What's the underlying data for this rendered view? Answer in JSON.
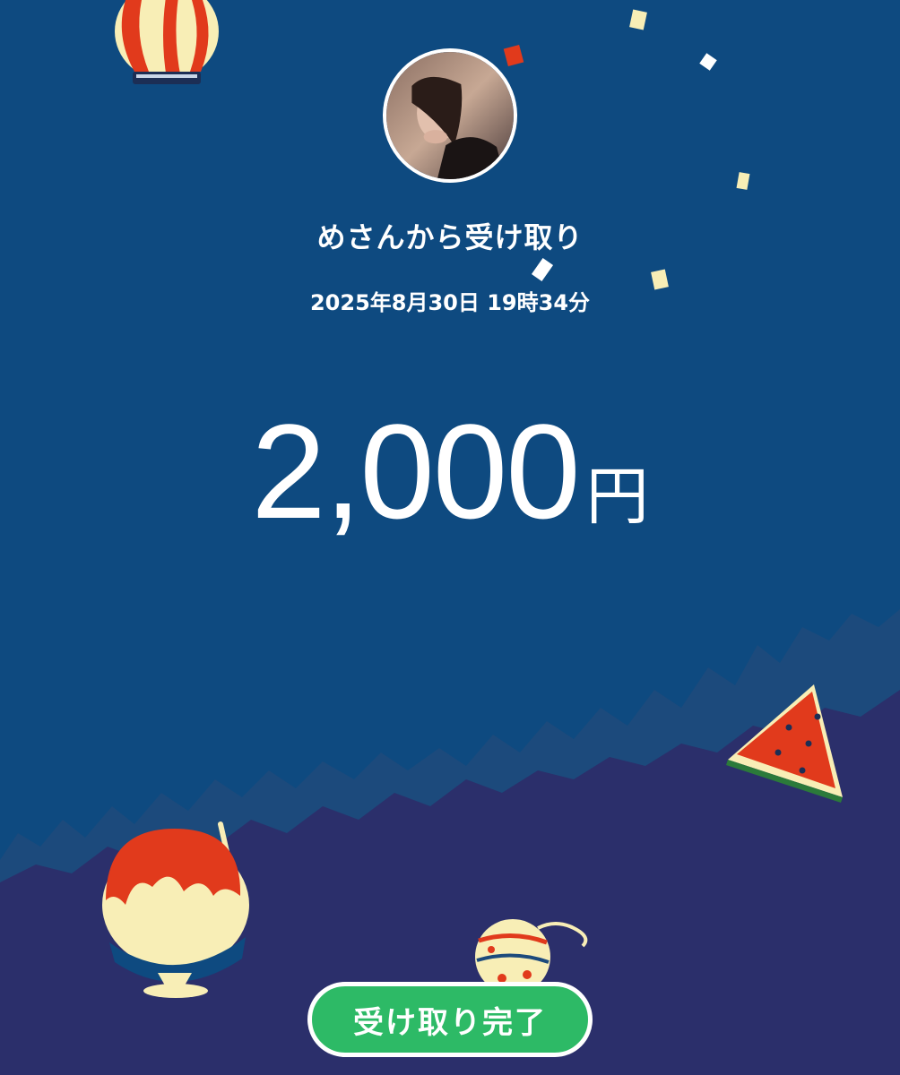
{
  "colors": {
    "sky": "#0e4a80",
    "foliage": "#1c4a7c",
    "ground": "#2b2f6b",
    "button": "#2dba66",
    "accent_red": "#e13a1c",
    "accent_cream": "#f8eeb6"
  },
  "receipt": {
    "sender_line": "めさんから受け取り",
    "datetime": "2025年8月30日 19時34分",
    "amount_value": "2,000",
    "amount_unit": "円"
  },
  "actions": {
    "done_label": "受け取り完了"
  },
  "icons": [
    "paper-lantern-icon",
    "watermelon-icon",
    "shaved-ice-icon",
    "water-balloon-icon",
    "confetti-icon"
  ]
}
